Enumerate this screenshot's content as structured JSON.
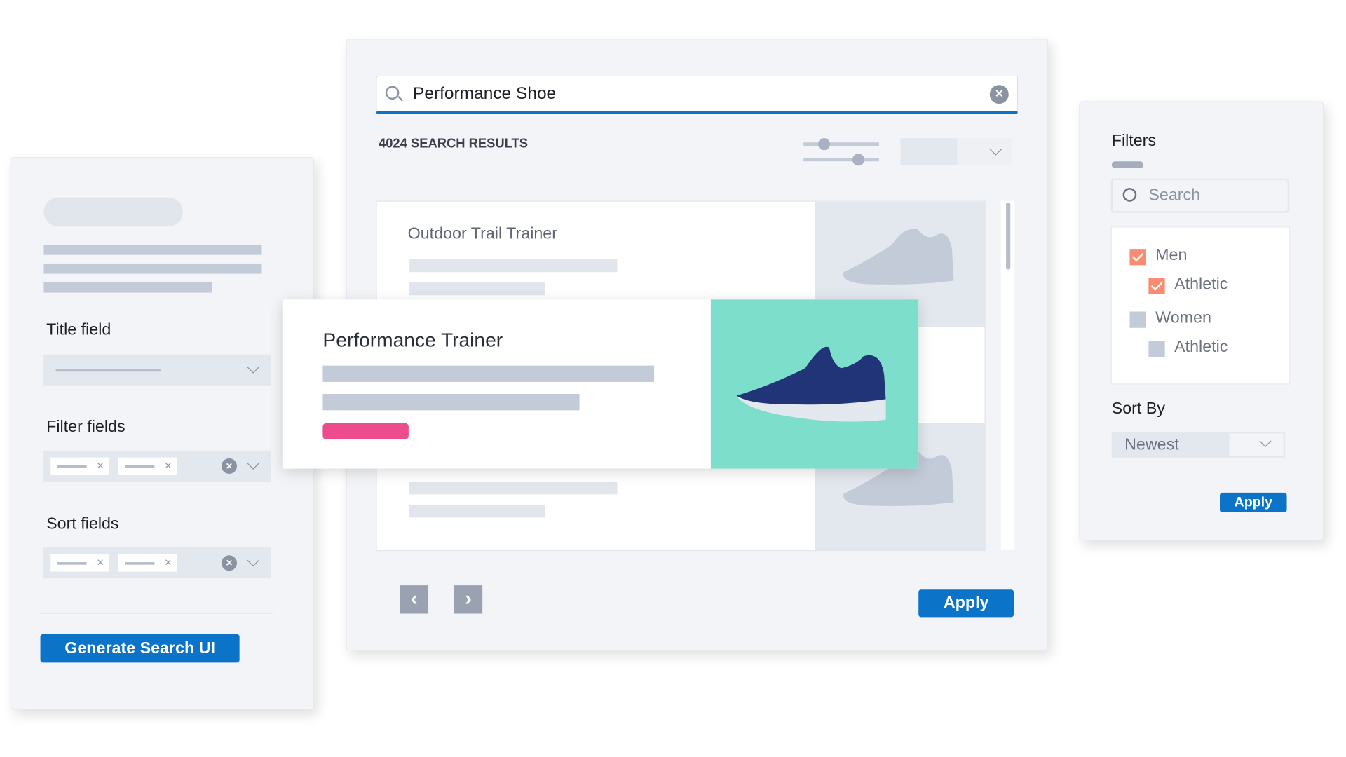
{
  "config_panel": {
    "title_field_label": "Title field",
    "filter_fields_label": "Filter fields",
    "sort_fields_label": "Sort fields",
    "generate_button": "Generate Search UI"
  },
  "search": {
    "query": "Performance Shoe",
    "results_count": "4024 SEARCH RESULTS",
    "results": [
      {
        "title": "Outdoor Trail Trainer"
      },
      {
        "title": "Performance Trainer",
        "accent": "#7ddfcb",
        "shoe_color": "#213478",
        "tag_color": "#ec4c8c"
      }
    ],
    "apply_label": "Apply"
  },
  "filters": {
    "title": "Filters",
    "search_placeholder": "Search",
    "options": [
      {
        "label": "Men",
        "checked": true
      },
      {
        "label": "Athletic",
        "checked": true
      },
      {
        "label": "Women",
        "checked": false
      },
      {
        "label": "Athletic",
        "checked": false
      }
    ],
    "sort_label": "Sort By",
    "sort_value": "Newest",
    "apply_label": "Apply"
  },
  "colors": {
    "primary": "#0b74c9",
    "checkbox_on": "#fa8c74"
  }
}
